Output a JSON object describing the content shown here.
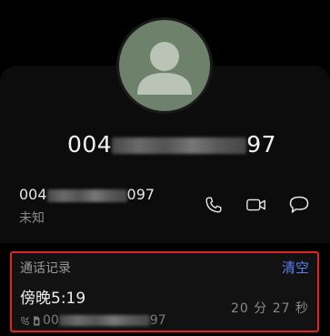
{
  "contact": {
    "number_prefix": "004",
    "number_suffix": "97",
    "avatar_icon": "person-silhouette-icon"
  },
  "detail_row": {
    "number_prefix": "004",
    "number_suffix": "097",
    "label": "未知",
    "actions": [
      {
        "icon": "phone-icon"
      },
      {
        "icon": "video-call-icon"
      },
      {
        "icon": "message-icon"
      }
    ]
  },
  "call_log": {
    "title": "通话记录",
    "clear_label": "清空",
    "entry": {
      "time": "傍晚5:19",
      "number_prefix": "00",
      "number_suffix": "97",
      "duration": "20 分 27 秒",
      "icons": [
        "incoming-call-icon",
        "sim-card-icon"
      ]
    }
  },
  "colors": {
    "background": "#000000",
    "card": "#0c0c0c",
    "accent": "#5b7ef5",
    "highlight_border": "#e0242a",
    "avatar_bg": "#6e816b"
  }
}
